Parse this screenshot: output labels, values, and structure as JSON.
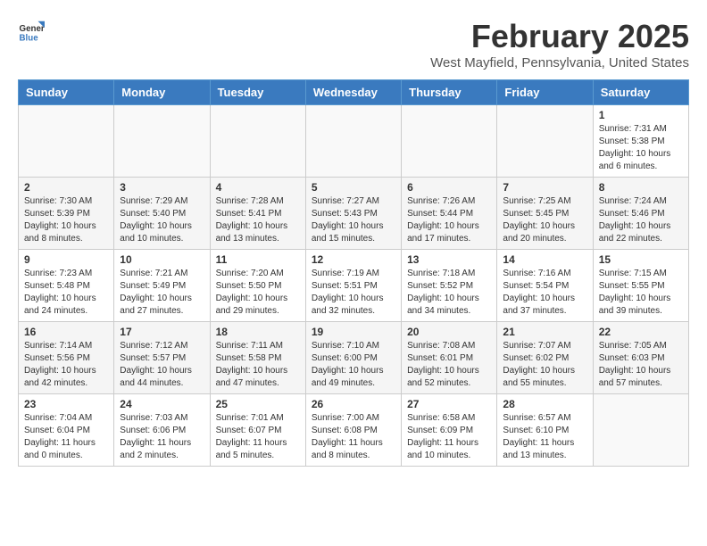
{
  "logo": {
    "general": "General",
    "blue": "Blue"
  },
  "title": "February 2025",
  "subtitle": "West Mayfield, Pennsylvania, United States",
  "weekdays": [
    "Sunday",
    "Monday",
    "Tuesday",
    "Wednesday",
    "Thursday",
    "Friday",
    "Saturday"
  ],
  "weeks": [
    [
      {
        "day": "",
        "info": ""
      },
      {
        "day": "",
        "info": ""
      },
      {
        "day": "",
        "info": ""
      },
      {
        "day": "",
        "info": ""
      },
      {
        "day": "",
        "info": ""
      },
      {
        "day": "",
        "info": ""
      },
      {
        "day": "1",
        "info": "Sunrise: 7:31 AM\nSunset: 5:38 PM\nDaylight: 10 hours\nand 6 minutes."
      }
    ],
    [
      {
        "day": "2",
        "info": "Sunrise: 7:30 AM\nSunset: 5:39 PM\nDaylight: 10 hours\nand 8 minutes."
      },
      {
        "day": "3",
        "info": "Sunrise: 7:29 AM\nSunset: 5:40 PM\nDaylight: 10 hours\nand 10 minutes."
      },
      {
        "day": "4",
        "info": "Sunrise: 7:28 AM\nSunset: 5:41 PM\nDaylight: 10 hours\nand 13 minutes."
      },
      {
        "day": "5",
        "info": "Sunrise: 7:27 AM\nSunset: 5:43 PM\nDaylight: 10 hours\nand 15 minutes."
      },
      {
        "day": "6",
        "info": "Sunrise: 7:26 AM\nSunset: 5:44 PM\nDaylight: 10 hours\nand 17 minutes."
      },
      {
        "day": "7",
        "info": "Sunrise: 7:25 AM\nSunset: 5:45 PM\nDaylight: 10 hours\nand 20 minutes."
      },
      {
        "day": "8",
        "info": "Sunrise: 7:24 AM\nSunset: 5:46 PM\nDaylight: 10 hours\nand 22 minutes."
      }
    ],
    [
      {
        "day": "9",
        "info": "Sunrise: 7:23 AM\nSunset: 5:48 PM\nDaylight: 10 hours\nand 24 minutes."
      },
      {
        "day": "10",
        "info": "Sunrise: 7:21 AM\nSunset: 5:49 PM\nDaylight: 10 hours\nand 27 minutes."
      },
      {
        "day": "11",
        "info": "Sunrise: 7:20 AM\nSunset: 5:50 PM\nDaylight: 10 hours\nand 29 minutes."
      },
      {
        "day": "12",
        "info": "Sunrise: 7:19 AM\nSunset: 5:51 PM\nDaylight: 10 hours\nand 32 minutes."
      },
      {
        "day": "13",
        "info": "Sunrise: 7:18 AM\nSunset: 5:52 PM\nDaylight: 10 hours\nand 34 minutes."
      },
      {
        "day": "14",
        "info": "Sunrise: 7:16 AM\nSunset: 5:54 PM\nDaylight: 10 hours\nand 37 minutes."
      },
      {
        "day": "15",
        "info": "Sunrise: 7:15 AM\nSunset: 5:55 PM\nDaylight: 10 hours\nand 39 minutes."
      }
    ],
    [
      {
        "day": "16",
        "info": "Sunrise: 7:14 AM\nSunset: 5:56 PM\nDaylight: 10 hours\nand 42 minutes."
      },
      {
        "day": "17",
        "info": "Sunrise: 7:12 AM\nSunset: 5:57 PM\nDaylight: 10 hours\nand 44 minutes."
      },
      {
        "day": "18",
        "info": "Sunrise: 7:11 AM\nSunset: 5:58 PM\nDaylight: 10 hours\nand 47 minutes."
      },
      {
        "day": "19",
        "info": "Sunrise: 7:10 AM\nSunset: 6:00 PM\nDaylight: 10 hours\nand 49 minutes."
      },
      {
        "day": "20",
        "info": "Sunrise: 7:08 AM\nSunset: 6:01 PM\nDaylight: 10 hours\nand 52 minutes."
      },
      {
        "day": "21",
        "info": "Sunrise: 7:07 AM\nSunset: 6:02 PM\nDaylight: 10 hours\nand 55 minutes."
      },
      {
        "day": "22",
        "info": "Sunrise: 7:05 AM\nSunset: 6:03 PM\nDaylight: 10 hours\nand 57 minutes."
      }
    ],
    [
      {
        "day": "23",
        "info": "Sunrise: 7:04 AM\nSunset: 6:04 PM\nDaylight: 11 hours\nand 0 minutes."
      },
      {
        "day": "24",
        "info": "Sunrise: 7:03 AM\nSunset: 6:06 PM\nDaylight: 11 hours\nand 2 minutes."
      },
      {
        "day": "25",
        "info": "Sunrise: 7:01 AM\nSunset: 6:07 PM\nDaylight: 11 hours\nand 5 minutes."
      },
      {
        "day": "26",
        "info": "Sunrise: 7:00 AM\nSunset: 6:08 PM\nDaylight: 11 hours\nand 8 minutes."
      },
      {
        "day": "27",
        "info": "Sunrise: 6:58 AM\nSunset: 6:09 PM\nDaylight: 11 hours\nand 10 minutes."
      },
      {
        "day": "28",
        "info": "Sunrise: 6:57 AM\nSunset: 6:10 PM\nDaylight: 11 hours\nand 13 minutes."
      },
      {
        "day": "",
        "info": ""
      }
    ]
  ]
}
